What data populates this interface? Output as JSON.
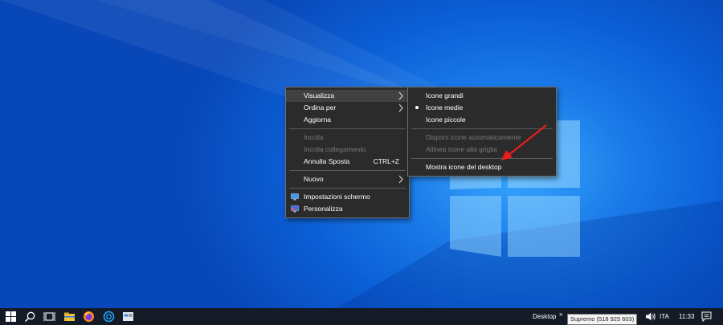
{
  "context_menu": {
    "items": [
      {
        "label": "Visualizza",
        "submenu": true,
        "highlighted": true
      },
      {
        "label": "Ordina per",
        "submenu": true
      },
      {
        "label": "Aggiorna"
      },
      {
        "label": "Incolla",
        "disabled": true
      },
      {
        "label": "Incolla collegamento",
        "disabled": true
      },
      {
        "label": "Annulla Sposta",
        "shortcut": "CTRL+Z"
      },
      {
        "label": "Nuovo",
        "submenu": true
      },
      {
        "label": "Impostazioni schermo",
        "icon": "display-settings-icon"
      },
      {
        "label": "Personalizza",
        "icon": "personalize-icon"
      }
    ]
  },
  "view_submenu": {
    "items": [
      {
        "label": "Icone grandi"
      },
      {
        "label": "Icone medie",
        "selected": true
      },
      {
        "label": "Icone piccole"
      },
      {
        "label": "Disponi icone automaticamente",
        "disabled": true
      },
      {
        "label": "Allinea icone alla griglia",
        "disabled": true
      },
      {
        "label": "Mostra icone del desktop"
      }
    ]
  },
  "annotation": {
    "icon": "red-arrow-icon",
    "color": "#e81e1e"
  },
  "taskbar": {
    "icons": [
      "start-icon",
      "search-icon",
      "task-view-icon",
      "file-explorer-icon",
      "firefox-icon",
      "app-icon",
      "remote-app-icon"
    ],
    "desktop_label": "Desktop",
    "language": "ITA",
    "time": "11:33"
  },
  "tooltip": "Supremo (518 925 603)",
  "colors": {
    "menu_bg": "#2b2b2b",
    "taskbar_bg": "#141b26",
    "desktop_blue": "#0b5fd6"
  }
}
